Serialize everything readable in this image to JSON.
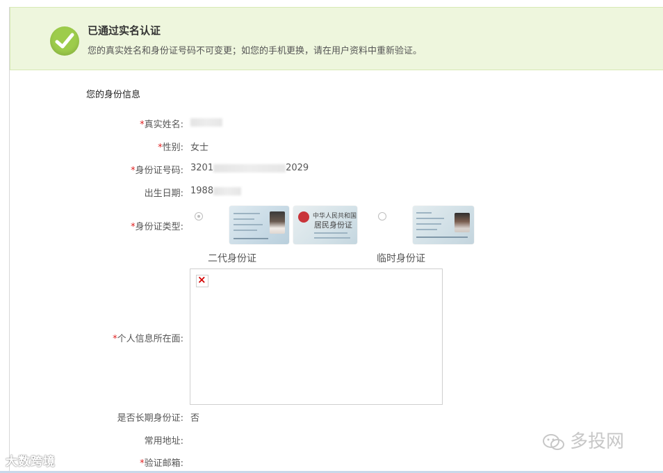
{
  "banner": {
    "title": "已通过实名认证",
    "description": "您的真实姓名和身份证号码不可变更；如您的手机更换，请在用户资料中重新验证。",
    "icon": "check-circle-icon",
    "accent_color": "#9dcc4b"
  },
  "section_title": "您的身份信息",
  "fields": {
    "real_name": {
      "label": "真实姓名:",
      "required": "*",
      "value": ""
    },
    "gender": {
      "label": "性别:",
      "required": "*",
      "value": "女士"
    },
    "id_number": {
      "label": "身份证号码:",
      "required": "*",
      "value_prefix": "3201",
      "value_suffix": "2029"
    },
    "birth_date": {
      "label": "出生日期:",
      "value_prefix": "1988"
    },
    "id_type": {
      "label": "身份证类型:",
      "required": "*",
      "options": [
        {
          "caption": "二代身份证",
          "selected": true
        },
        {
          "caption": "临时身份证",
          "selected": false
        }
      ]
    },
    "id_front": {
      "label": "个人信息所在面:",
      "required": "*"
    },
    "long_term": {
      "label": "是否长期身份证:",
      "value": "否"
    },
    "address": {
      "label": "常用地址:",
      "value": ""
    },
    "email": {
      "label": "验证邮箱:",
      "required": "*",
      "value": ""
    }
  },
  "id_card_text": {
    "front_header": "中华人民共和国",
    "front_title": "居民身份证"
  },
  "watermarks": {
    "left": "大数跨境",
    "right": "多投网"
  }
}
